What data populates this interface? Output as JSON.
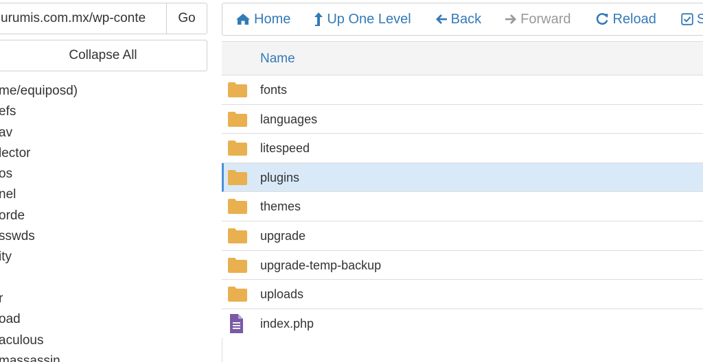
{
  "location": {
    "path_value": "urumis.com.mx/wp-conte",
    "go_label": "Go"
  },
  "tree": {
    "collapse_label": "Collapse All",
    "items": [
      "me/equiposd)",
      "efs",
      "av",
      "lector",
      "os",
      "nel",
      "orde",
      "sswds",
      "ity",
      "",
      "r",
      "oad",
      "aculous",
      "massassin"
    ]
  },
  "toolbar": {
    "home": "Home",
    "up": "Up One Level",
    "back": "Back",
    "forward": "Forward",
    "reload": "Reload",
    "select": "Se"
  },
  "table": {
    "header_name": "Name",
    "rows": [
      {
        "name": "fonts",
        "type": "folder"
      },
      {
        "name": "languages",
        "type": "folder"
      },
      {
        "name": "litespeed",
        "type": "folder"
      },
      {
        "name": "plugins",
        "type": "folder",
        "selected": true
      },
      {
        "name": "themes",
        "type": "folder"
      },
      {
        "name": "upgrade",
        "type": "folder"
      },
      {
        "name": "upgrade-temp-backup",
        "type": "folder"
      },
      {
        "name": "uploads",
        "type": "folder"
      },
      {
        "name": "index.php",
        "type": "php-file"
      }
    ]
  },
  "colors": {
    "link_blue": "#337ab7",
    "folder_orange": "#e8b04f",
    "file_purple": "#7a5aa6",
    "selected_bg": "#d9e9f7"
  }
}
